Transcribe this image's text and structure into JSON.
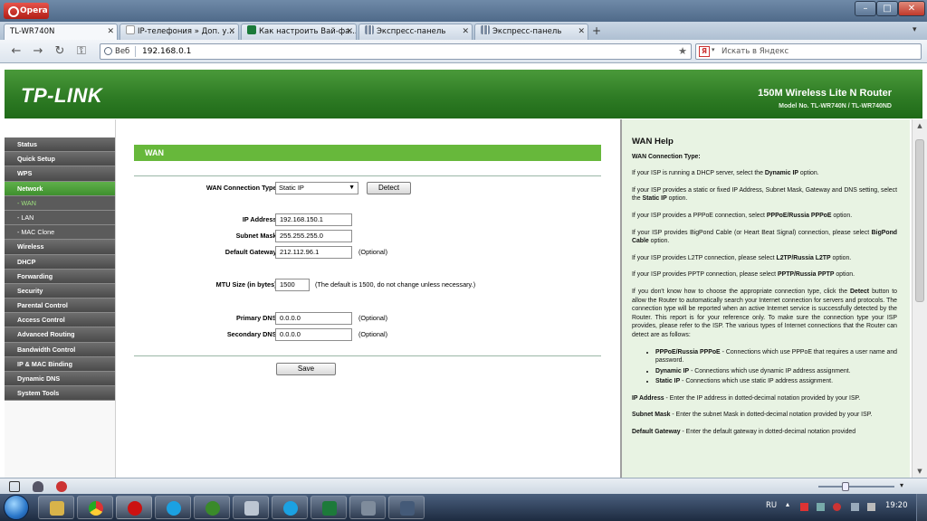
{
  "browser": {
    "name": "Opera",
    "tabs": [
      {
        "label": "TL-WR740N",
        "active": true
      },
      {
        "label": "IP-телефония » Доп. у...",
        "active": false
      },
      {
        "label": "Как настроить Вай-фа...",
        "active": false
      },
      {
        "label": "Экспресс-панель",
        "active": false
      },
      {
        "label": "Экспресс-панель",
        "active": false
      }
    ],
    "address_label": "Веб",
    "url": "192.168.0.1",
    "search_placeholder": "Искать в Яндекс"
  },
  "router": {
    "logo": "TP-LINK",
    "product_name": "150M Wireless Lite N Router",
    "model_no": "Model No. TL-WR740N / TL-WR740ND"
  },
  "menu": [
    {
      "label": "Status"
    },
    {
      "label": "Quick Setup"
    },
    {
      "label": "WPS"
    },
    {
      "label": "Network"
    },
    {
      "label": "- WAN"
    },
    {
      "label": "- LAN"
    },
    {
      "label": "- MAC Clone"
    },
    {
      "label": "Wireless"
    },
    {
      "label": "DHCP"
    },
    {
      "label": "Forwarding"
    },
    {
      "label": "Security"
    },
    {
      "label": "Parental Control"
    },
    {
      "label": "Access Control"
    },
    {
      "label": "Advanced Routing"
    },
    {
      "label": "Bandwidth Control"
    },
    {
      "label": "IP & MAC Binding"
    },
    {
      "label": "Dynamic DNS"
    },
    {
      "label": "System Tools"
    }
  ],
  "wan": {
    "title": "WAN",
    "connection_type_label": "WAN Connection Type:",
    "connection_type_value": "Static IP",
    "detect_label": "Detect",
    "ip_label": "IP Address:",
    "ip_value": "192.168.150.1",
    "mask_label": "Subnet Mask:",
    "mask_value": "255.255.255.0",
    "gateway_label": "Default Gateway:",
    "gateway_value": "212.112.96.1",
    "optional": "(Optional)",
    "mtu_label": "MTU Size (in bytes):",
    "mtu_value": "1500",
    "mtu_note": "(The default is 1500, do not change unless necessary.)",
    "dns1_label": "Primary DNS:",
    "dns1_value": "0.0.0.0",
    "dns2_label": "Secondary DNS:",
    "dns2_value": "0.0.0.0",
    "save_label": "Save"
  },
  "help": {
    "title": "WAN Help",
    "subtitle": "WAN Connection Type:",
    "p1a": "If your ISP is running a DHCP server, select the ",
    "p1b": "Dynamic IP",
    "p1c": " option.",
    "p2a": "If your ISP provides a static or fixed IP Address, Subnet Mask, Gateway and DNS setting, select the ",
    "p2b": "Static IP",
    "p2c": " option.",
    "p3a": "If your ISP provides a PPPoE connection, select ",
    "p3b": "PPPoE/Russia PPPoE",
    "p3c": " option.",
    "p4a": "If your ISP provides BigPond Cable (or Heart Beat Signal) connection, please select ",
    "p4b": "BigPond Cable",
    "p4c": " option.",
    "p5a": "If your ISP provides L2TP connection, please select ",
    "p5b": "L2TP/Russia L2TP",
    "p5c": " option.",
    "p6a": "If your ISP provides PPTP connection, please select ",
    "p6b": "PPTP/Russia PPTP",
    "p6c": " option.",
    "p7a": "If you don't know how to choose the appropriate connection type, click the ",
    "p7b": "Detect",
    "p7c": " button to allow the Router to automatically search your Internet connection for servers and protocols. The connection type will be reported when an active Internet service is successfully detected by the Router. This report is for your reference only. To make sure the connection type your ISP provides, please refer to the ISP. The various types of Internet connections that the Router can detect are as follows:",
    "li1a": "PPPoE/Russia PPPoE",
    "li1b": " - Connections which use PPPoE that requires a user name and password.",
    "li2a": "Dynamic IP",
    "li2b": " - Connections which use dynamic IP address assignment.",
    "li3a": "Static IP",
    "li3b": " - Connections which use static IP address assignment.",
    "p8a": "IP Address",
    "p8b": " - Enter the IP address in dotted-decimal notation provided by your ISP.",
    "p9a": "Subnet Mask",
    "p9b": " - Enter the subnet Mask in dotted-decimal notation provided by your ISP.",
    "p10a": "Default Gateway",
    "p10b": " - Enter the default gateway in dotted-decimal notation provided"
  },
  "taskbar": {
    "language": "RU",
    "time": "19:20"
  },
  "colors": {
    "router_green": "#2f7c25",
    "menu_active": "#4fa03a",
    "section_bar": "#67b83b",
    "help_bg": "#e8f3e3"
  }
}
